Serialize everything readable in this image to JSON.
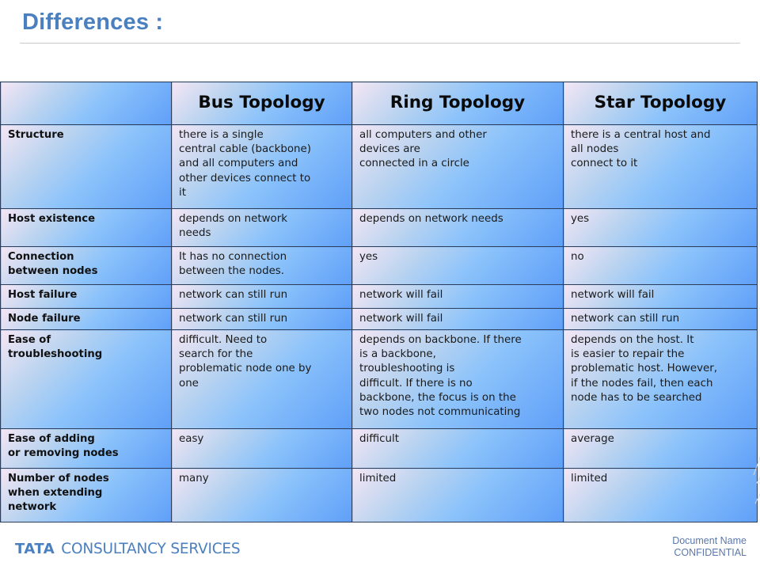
{
  "slide": {
    "title": "Differences :"
  },
  "table": {
    "headers": [
      "",
      "Bus Topology",
      "Ring Topology",
      "Star Topology"
    ],
    "rows": [
      {
        "label": "Structure",
        "bus": "there is a single\ncentral cable (backbone)\nand all computers and\nother devices connect to\nit",
        "ring": "all computers and other\ndevices are\nconnected in a circle",
        "star": "there is a central host and\nall nodes\nconnect to it"
      },
      {
        "label": "Host existence",
        "bus": "depends on network\nneeds",
        "ring": "depends on network needs",
        "star": "yes"
      },
      {
        "label": "Connection\nbetween nodes",
        "bus": "It has no connection\nbetween the nodes.",
        "ring": "yes",
        "star": "no"
      },
      {
        "label": "Host failure",
        "bus": "network can still run",
        "ring": "network will fail",
        "star": "network will fail"
      },
      {
        "label": "Node failure",
        "bus": "network can still run",
        "ring": "network will fail",
        "star": "network can still run"
      },
      {
        "label": "Ease of\ntroubleshooting",
        "bus": "difficult.  Need to\nsearch for the\nproblematic node one by\none",
        "ring": "depends on backbone. If there\nis a backbone,\ntroubleshooting is\ndifficult. If there is no\nbackbone, the focus is on the\ntwo nodes not communicating",
        "star": "depends on the host. It\nis easier to repair the\nproblematic host. However,\nif the nodes fail, then each\nnode has to be searched"
      },
      {
        "label": "Ease of adding\nor removing nodes",
        "bus": "easy",
        "ring": "difficult",
        "star": "average"
      },
      {
        "label": "Number of nodes\nwhen extending\nnetwork",
        "bus": "many",
        "ring": "limited",
        "star": "limited"
      }
    ]
  },
  "footer": {
    "logo_mark": "TATA",
    "logo_text": "CONSULTANCY SERVICES",
    "document_name": "Document Name",
    "classification": "CONFIDENTIAL"
  },
  "colors": {
    "title": "#4a7fc0",
    "table_border": "#2d3d5c",
    "cell_gradient_start": "#f4e6f4",
    "cell_gradient_end": "#5f9ff8",
    "footer_text": "#5a78ad"
  }
}
